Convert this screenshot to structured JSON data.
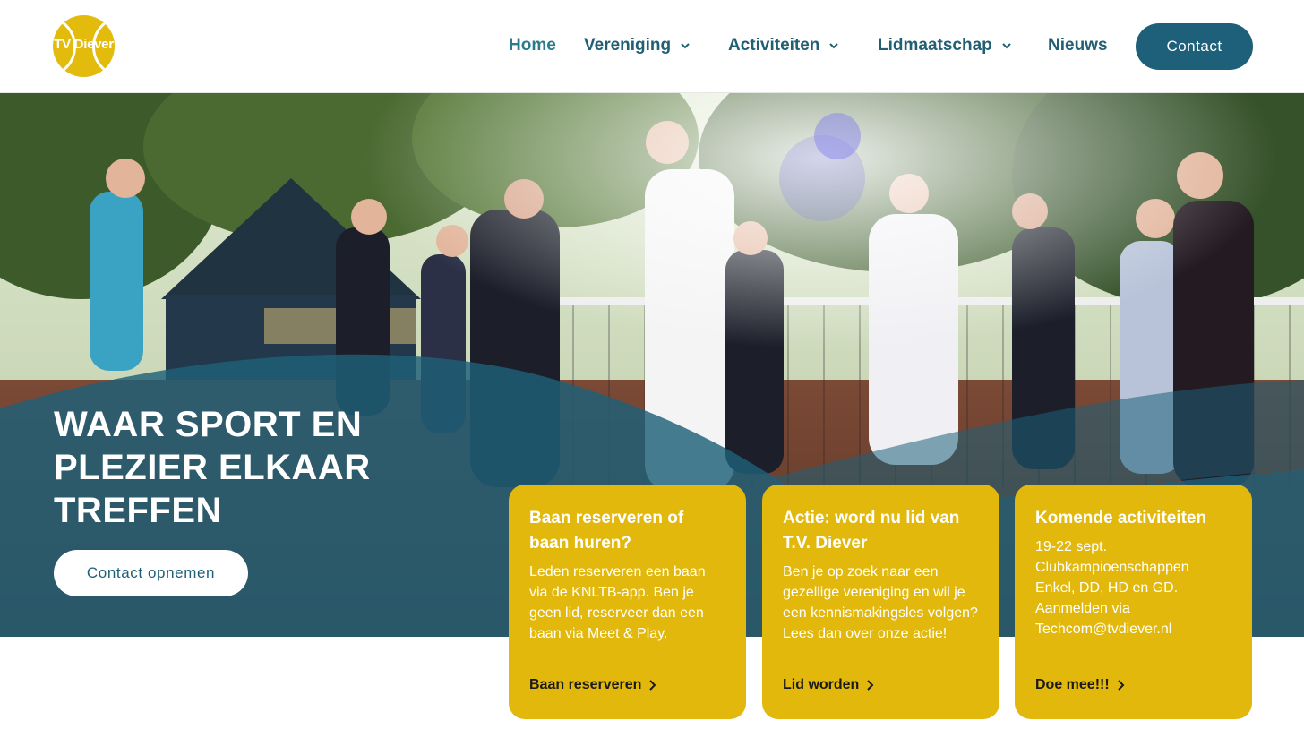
{
  "brand": {
    "logo_text": "TV Diever"
  },
  "nav": {
    "items": [
      {
        "label": "Home",
        "has_dropdown": false,
        "active": true
      },
      {
        "label": "Vereniging",
        "has_dropdown": true
      },
      {
        "label": "Activiteiten",
        "has_dropdown": true
      },
      {
        "label": "Lidmaatschap",
        "has_dropdown": true
      },
      {
        "label": "Nieuws",
        "has_dropdown": false
      }
    ],
    "contact_label": "Contact"
  },
  "hero": {
    "title": "WAAR SPORT EN PLEZIER ELKAAR TREFFEN",
    "button_label": "Contact opnemen"
  },
  "cards": [
    {
      "title": "Baan reserveren of baan huren?",
      "body": "Leden reserveren een baan via de KNLTB-app. Ben je geen lid, reserveer dan een baan via Meet & Play.",
      "link": "Baan reserveren"
    },
    {
      "title": "Actie: word nu lid van T.V. Diever",
      "body": "Ben je op zoek naar een gezellige vereniging en wil je een kennismakingsles volgen? Lees dan over onze actie!",
      "link": "Lid worden"
    },
    {
      "title": "Komende activiteiten",
      "body": "19-22 sept. Clubkampioenschappen Enkel, DD, HD en GD. Aanmelden via Techcom@tvdiever.nl",
      "link": "Doe mee!!!"
    }
  ],
  "colors": {
    "primary": "#1e6079",
    "nav_text": "#215f73",
    "accent_yellow": "#e2b80c",
    "white": "#ffffff"
  },
  "icons": {
    "dropdown": "chevron-down-icon",
    "card_link": "chevron-right-icon"
  }
}
